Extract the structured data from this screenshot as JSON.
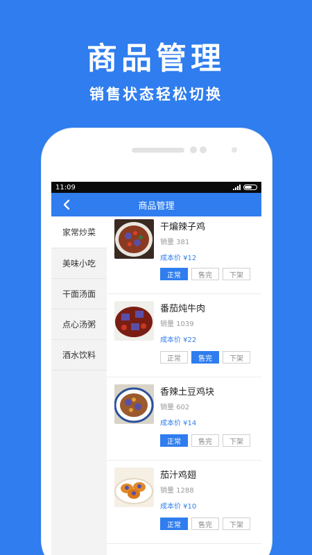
{
  "promo": {
    "title": "商品管理",
    "subtitle": "销售状态轻松切换"
  },
  "statusbar": {
    "time": "11:09"
  },
  "navbar": {
    "title": "商品管理"
  },
  "categories": [
    {
      "label": "家常炒菜",
      "active": true
    },
    {
      "label": "美味小吃",
      "active": false
    },
    {
      "label": "干面汤面",
      "active": false
    },
    {
      "label": "点心汤粥",
      "active": false
    },
    {
      "label": "酒水饮料",
      "active": false
    }
  ],
  "goods": [
    {
      "name": "干煸辣子鸡",
      "sales": "销量 381",
      "cost": "成本价 ¥12",
      "status": "正常"
    },
    {
      "name": "番茄炖牛肉",
      "sales": "销量 1039",
      "cost": "成本价 ¥22",
      "status": "售完"
    },
    {
      "name": "香辣土豆鸡块",
      "sales": "销量 602",
      "cost": "成本价 ¥14",
      "status": "正常"
    },
    {
      "name": "茄汁鸡翅",
      "sales": "销量 1288",
      "cost": "成本价 ¥10",
      "status": "正常"
    }
  ],
  "status_buttons": [
    "正常",
    "售完",
    "下架"
  ],
  "colors": {
    "accent": "#2f7dee",
    "background": "#2f7dee"
  }
}
